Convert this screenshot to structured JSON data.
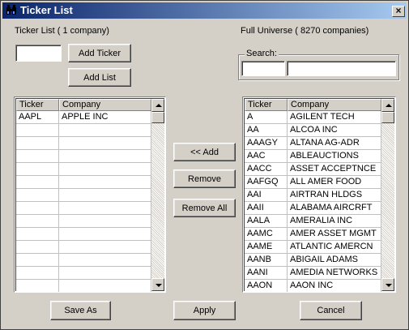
{
  "window": {
    "title": "Ticker List",
    "close_glyph": "×",
    "icon": "binoculars-icon"
  },
  "left": {
    "caption": "Ticker List ( 1 company)",
    "ticker_input_value": "",
    "add_ticker_label": "Add Ticker",
    "add_list_label": "Add List",
    "columns": [
      "Ticker",
      "Company"
    ],
    "rows": [
      {
        "ticker": "AAPL",
        "company": "APPLE INC"
      }
    ],
    "empty_row_count": 13
  },
  "middle": {
    "add_label": "<< Add",
    "remove_label": "Remove",
    "remove_all_label": "Remove All"
  },
  "right": {
    "caption": "Full Universe ( 8270 companies)",
    "search_label": "Search:",
    "search_ticker_value": "",
    "search_company_value": "",
    "columns": [
      "Ticker",
      "Company"
    ],
    "rows": [
      {
        "ticker": "A",
        "company": "AGILENT TECH"
      },
      {
        "ticker": "AA",
        "company": "ALCOA INC"
      },
      {
        "ticker": "AAAGY",
        "company": "ALTANA AG-ADR"
      },
      {
        "ticker": "AAC",
        "company": "ABLEAUCTIONS"
      },
      {
        "ticker": "AACC",
        "company": "ASSET ACCEPTNCE"
      },
      {
        "ticker": "AAFGQ",
        "company": "ALL AMER FOOD"
      },
      {
        "ticker": "AAI",
        "company": "AIRTRAN HLDGS"
      },
      {
        "ticker": "AAII",
        "company": "ALABAMA AIRCRFT"
      },
      {
        "ticker": "AALA",
        "company": "AMERALIA INC"
      },
      {
        "ticker": "AAMC",
        "company": "AMER ASSET MGMT"
      },
      {
        "ticker": "AAME",
        "company": "ATLANTIC AMERCN"
      },
      {
        "ticker": "AANB",
        "company": "ABIGAIL ADAMS"
      },
      {
        "ticker": "AANI",
        "company": "AMEDIA NETWORKS"
      },
      {
        "ticker": "AAON",
        "company": "AAON INC"
      }
    ]
  },
  "footer": {
    "save_as_label": "Save As",
    "apply_label": "Apply",
    "cancel_label": "Cancel"
  }
}
